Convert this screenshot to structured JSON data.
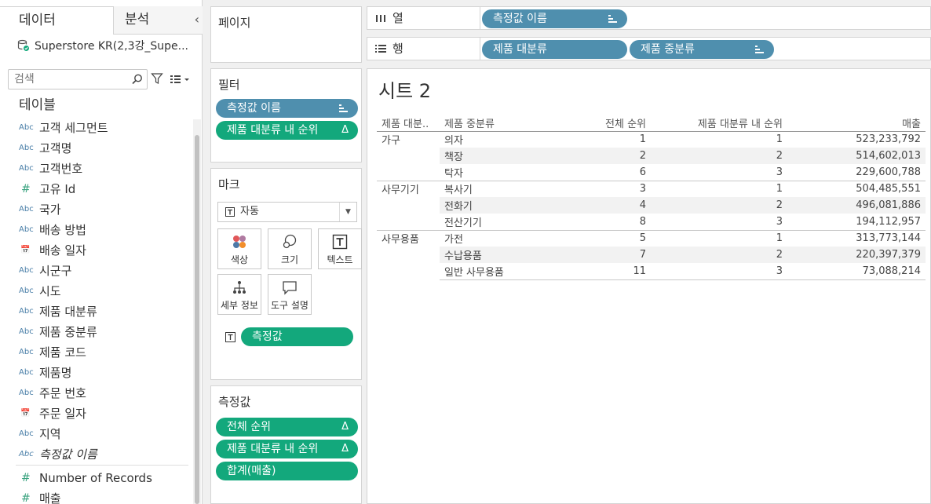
{
  "left_pane": {
    "tab_data": "데이터",
    "tab_analysis": "분석",
    "collapse_glyph": "‹",
    "datasource": "Superstore KR(2,3강_Supe...",
    "search_placeholder": "검색",
    "tables_title": "테이블",
    "fields": [
      {
        "type": "Abc",
        "name": "고객 세그먼트"
      },
      {
        "type": "Abc",
        "name": "고객명"
      },
      {
        "type": "Abc",
        "name": "고객번호"
      },
      {
        "type": "#",
        "name": "고유 Id"
      },
      {
        "type": "Abc",
        "name": "국가"
      },
      {
        "type": "Abc",
        "name": "배송 방법"
      },
      {
        "type": "cal",
        "name": "배송 일자"
      },
      {
        "type": "Abc",
        "name": "시군구"
      },
      {
        "type": "Abc",
        "name": "시도"
      },
      {
        "type": "Abc",
        "name": "제품 대분류"
      },
      {
        "type": "Abc",
        "name": "제품 중분류"
      },
      {
        "type": "Abc",
        "name": "제품 코드"
      },
      {
        "type": "Abc",
        "name": "제품명"
      },
      {
        "type": "Abc",
        "name": "주문 번호"
      },
      {
        "type": "cal",
        "name": "주문 일자"
      },
      {
        "type": "Abc",
        "name": "지역"
      },
      {
        "type": "Abc",
        "name": "측정값 이름"
      },
      {
        "type": "#",
        "name": "Number of Records"
      },
      {
        "type": "#",
        "name": "매출"
      }
    ]
  },
  "pages": {
    "title": "페이지"
  },
  "filters": {
    "title": "필터",
    "pills": [
      {
        "label": "측정값 이름",
        "color": "#4f8fae"
      },
      {
        "label": "제품 대분류 내 순위",
        "suffix": "Δ",
        "color": "#13a87c"
      }
    ]
  },
  "marks": {
    "title": "마크",
    "type": "자동",
    "buttons": {
      "color": "색상",
      "size": "크기",
      "text": "텍스트",
      "detail": "세부 정보",
      "tooltip": "도구 설명"
    },
    "text_pill": "측정값"
  },
  "measures": {
    "title": "측정값",
    "pills": [
      {
        "label": "전체 순위",
        "suffix": "Δ"
      },
      {
        "label": "제품 대분류 내 순위",
        "suffix": "Δ"
      },
      {
        "label": "합계(매출)"
      }
    ]
  },
  "columns": {
    "label": "열",
    "pill": "측정값 이름"
  },
  "rows": {
    "label": "행",
    "pills": [
      "제품 대분류",
      "제품 중분류"
    ]
  },
  "sheet": {
    "title": "시트 2",
    "headers": [
      "제품 대분..",
      "제품 중분류",
      "전체 순위",
      "제품 대분류 내 순위",
      "매출"
    ],
    "groups": [
      {
        "category": "가구",
        "rows": [
          {
            "sub": "의자",
            "overall": "1",
            "within": "1",
            "sales": "523,233,792"
          },
          {
            "sub": "책장",
            "overall": "2",
            "within": "2",
            "sales": "514,602,013"
          },
          {
            "sub": "탁자",
            "overall": "6",
            "within": "3",
            "sales": "229,600,788"
          }
        ]
      },
      {
        "category": "사무기기",
        "rows": [
          {
            "sub": "복사기",
            "overall": "3",
            "within": "1",
            "sales": "504,485,551"
          },
          {
            "sub": "전화기",
            "overall": "4",
            "within": "2",
            "sales": "496,081,886"
          },
          {
            "sub": "전산기기",
            "overall": "8",
            "within": "3",
            "sales": "194,112,957"
          }
        ]
      },
      {
        "category": "사무용품",
        "rows": [
          {
            "sub": "가전",
            "overall": "5",
            "within": "1",
            "sales": "313,773,144"
          },
          {
            "sub": "수납용품",
            "overall": "7",
            "within": "2",
            "sales": "220,397,379"
          },
          {
            "sub": "일반 사무용품",
            "overall": "11",
            "within": "3",
            "sales": "73,088,214"
          }
        ]
      }
    ]
  },
  "colors": {
    "blue_pill": "#4f8fae",
    "green_pill": "#13a87c"
  }
}
